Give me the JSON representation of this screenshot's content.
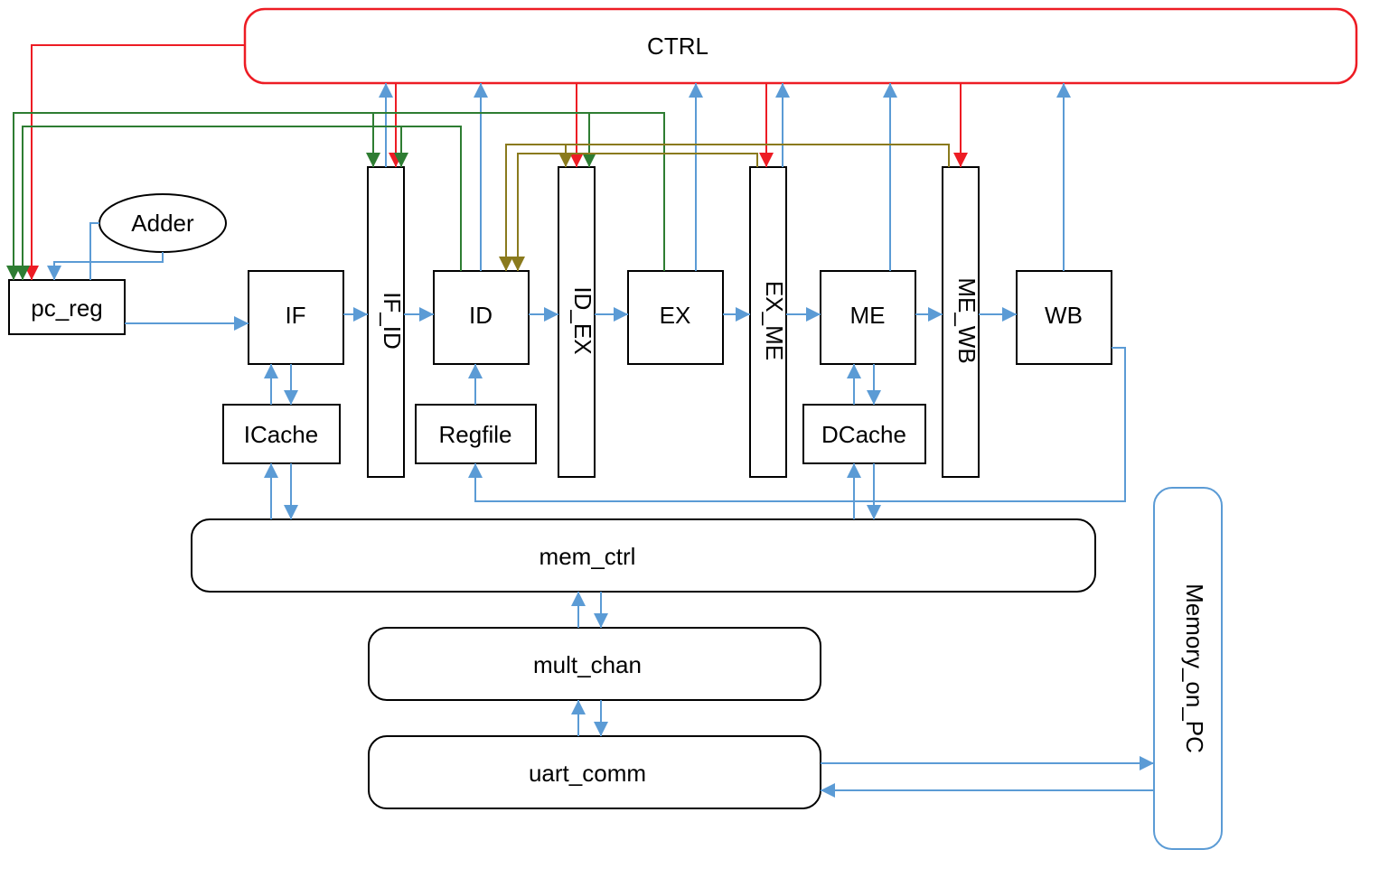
{
  "blocks": {
    "ctrl": "CTRL",
    "adder": "Adder",
    "pc_reg": "pc_reg",
    "if": "IF",
    "if_id": "IF_ID",
    "id": "ID",
    "id_ex": "ID_EX",
    "ex": "EX",
    "ex_me": "EX_ME",
    "me": "ME",
    "me_wb": "ME_WB",
    "wb": "WB",
    "icache": "ICache",
    "regfile": "Regfile",
    "dcache": "DCache",
    "mem_ctrl": "mem_ctrl",
    "mult_chan": "mult_chan",
    "uart_comm": "uart_comm",
    "memory_on_pc": "Memory_on_PC"
  },
  "colors": {
    "data_path": "#5b9bd5",
    "ctrl_out": "#ed1c24",
    "ctrl_fwd": "#2e7d32",
    "hazard": "#8a7a1d"
  }
}
